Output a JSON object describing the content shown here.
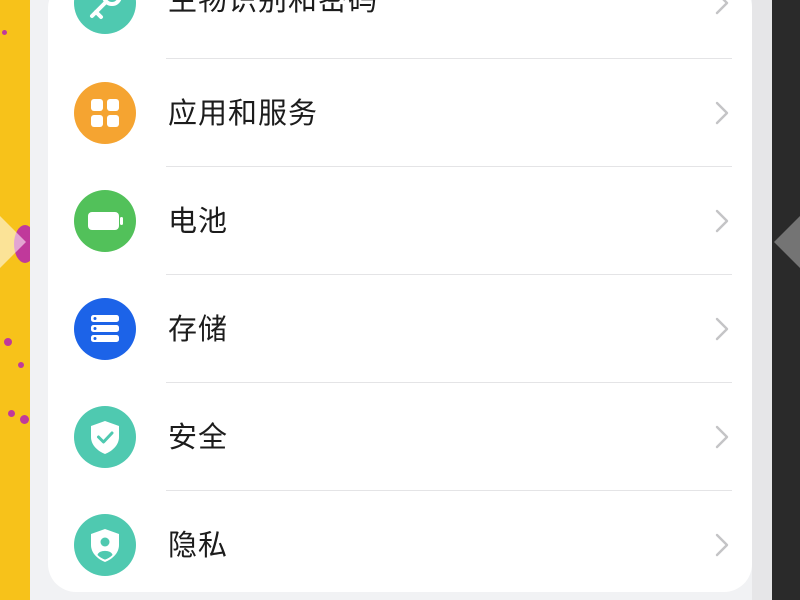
{
  "settings": {
    "items": [
      {
        "label": "生物识别和密码",
        "icon": "key-icon",
        "color": "#4fc9b0"
      },
      {
        "label": "应用和服务",
        "icon": "apps-grid-icon",
        "color": "#f5a431"
      },
      {
        "label": "电池",
        "icon": "battery-icon",
        "color": "#52c15a"
      },
      {
        "label": "存储",
        "icon": "storage-icon",
        "color": "#1c63e8"
      },
      {
        "label": "安全",
        "icon": "shield-check-icon",
        "color": "#4fc9b0"
      },
      {
        "label": "隐私",
        "icon": "privacy-shield-icon",
        "color": "#4fc9b0"
      }
    ]
  },
  "colors": {
    "background": "#f1f2f4",
    "card": "#ffffff",
    "text": "#1c1c1c",
    "chevron": "#c4c4c6",
    "divider": "#e4e4e6",
    "wallpaper_left": "#f7c21a"
  }
}
